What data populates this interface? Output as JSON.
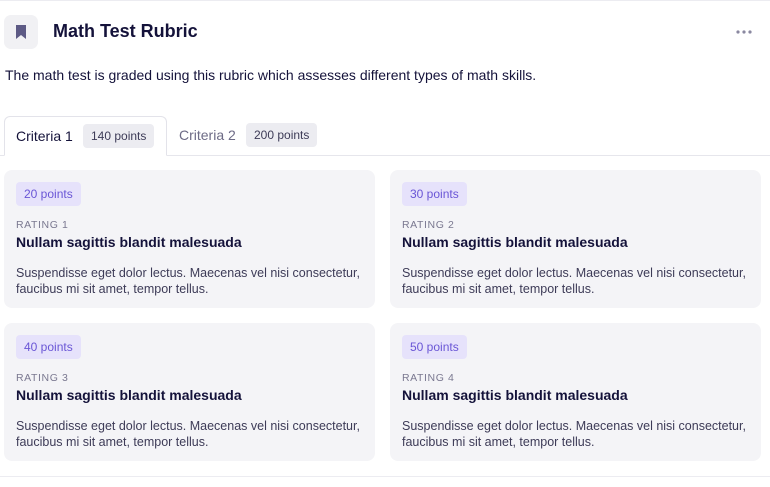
{
  "header": {
    "icon": "bookmark-icon",
    "title": "Math Test Rubric",
    "more_icon": "more-horizontal-icon"
  },
  "description": "The math test is graded using this rubric which assesses different types of math skills.",
  "tabs": [
    {
      "label": "Criteria 1",
      "badge": "140 points",
      "selected": true
    },
    {
      "label": "Criteria 2",
      "badge": "200 points",
      "selected": false
    }
  ],
  "ratings": [
    {
      "points": "20 points",
      "rating": "RATING 1",
      "title": "Nullam sagittis blandit malesuada",
      "text": "Suspendisse eget dolor lectus. Maecenas vel nisi consectetur, faucibus mi sit amet, tempor tellus."
    },
    {
      "points": "30 points",
      "rating": "RATING 2",
      "title": "Nullam sagittis blandit malesuada",
      "text": "Suspendisse eget dolor lectus. Maecenas vel nisi consectetur, faucibus mi sit amet, tempor tellus."
    },
    {
      "points": "40 points",
      "rating": "RATING 3",
      "title": "Nullam sagittis blandit malesuada",
      "text": "Suspendisse eget dolor lectus. Maecenas vel nisi consectetur, faucibus mi sit amet, tempor tellus."
    },
    {
      "points": "50 points",
      "rating": "RATING 4",
      "title": "Nullam sagittis blandit malesuada",
      "text": "Suspendisse eget dolor lectus. Maecenas vel nisi consectetur, faucibus mi sit amet, tempor tellus."
    }
  ],
  "colors": {
    "text": "#14123a",
    "accent": "#6a56d6",
    "accent_bg": "#e6e2fb",
    "card_bg": "#f4f4f7",
    "icon": "#5d5a85"
  }
}
